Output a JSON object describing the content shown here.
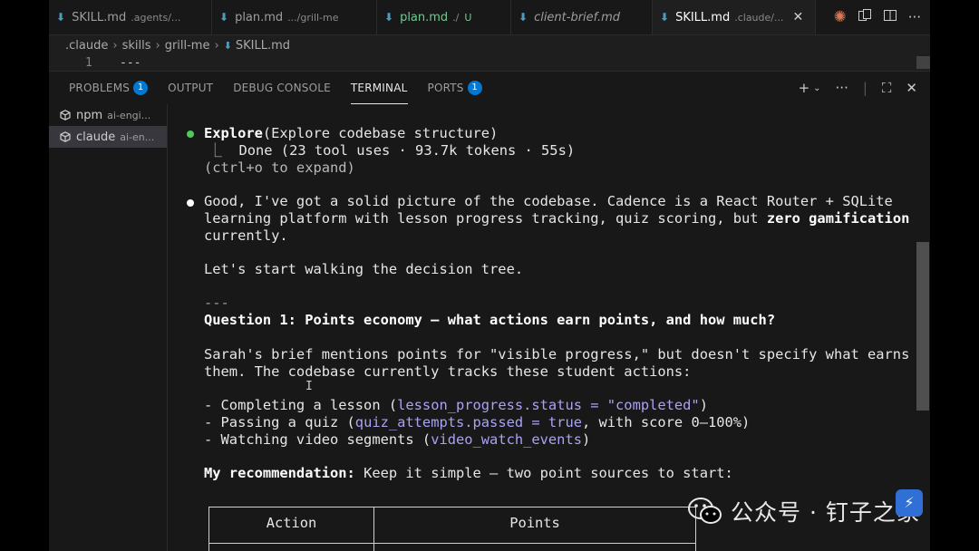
{
  "tabs": [
    {
      "label": "SKILL.md",
      "desc": ".agents/...",
      "style": "normal"
    },
    {
      "label": "plan.md",
      "desc": ".../grill-me",
      "style": "normal"
    },
    {
      "label": "plan.md",
      "desc": "./",
      "status": "U",
      "style": "modified"
    },
    {
      "label": "client-brief.md",
      "desc": "",
      "style": "italic"
    },
    {
      "label": "SKILL.md",
      "desc": ".claude/...",
      "style": "active"
    }
  ],
  "tab_close_glyph": "✕",
  "breadcrumb": [
    ".claude",
    "skills",
    "grill-me",
    "SKILL.md"
  ],
  "editor": {
    "line_number": "1",
    "line_text": "---"
  },
  "panel": {
    "tabs": [
      {
        "label": "PROBLEMS",
        "badge": "1"
      },
      {
        "label": "OUTPUT"
      },
      {
        "label": "DEBUG CONSOLE"
      },
      {
        "label": "TERMINAL",
        "active": true
      },
      {
        "label": "PORTS",
        "badge": "1"
      }
    ],
    "actions": {
      "add": "+",
      "dropdown": "⌄",
      "more": "···",
      "maximize": "⛶",
      "close": "✕"
    }
  },
  "terminals": [
    {
      "name": "npm",
      "desc": "ai-engi..."
    },
    {
      "name": "claude",
      "desc": "ai-en...",
      "active": true
    }
  ],
  "terminal": {
    "explore_tool": "Explore",
    "explore_args": "(Explore codebase structure)",
    "done_prefix": "  ⎿  ",
    "done_text": "Done (23 tool uses · 93.7k tokens · 55s)",
    "expand_hint": "(ctrl+o to expand)",
    "p1_line1": "Good, I've got a solid picture of the codebase. Cadence is a React Router + SQLite",
    "p1_line2a": "learning platform with lesson progress tracking, quiz scoring, but ",
    "p1_line2b": "zero gamification",
    "p1_line3": "currently.",
    "p2": "Let's start walking the decision tree.",
    "rule": "---",
    "question": "Question 1: Points economy — what actions earn points, and how much?",
    "p3_line1": "Sarah's brief mentions points for \"visible progress,\" but doesn't specify what earns",
    "p3_line2": "them. The codebase currently tracks these student actions:",
    "list": [
      {
        "pre": "- Completing a lesson (",
        "code": "lesson_progress.status = \"completed\"",
        "post": ")"
      },
      {
        "pre": "- Passing a quiz (",
        "code": "quiz_attempts.passed = true",
        "post": ", with score 0–100%)"
      },
      {
        "pre": "- Watching video segments (",
        "code": "video_watch_events",
        "post": ")"
      }
    ],
    "rec_label": "My recommendation:",
    "rec_text": " Keep it simple — two point sources to start:",
    "table_headers": [
      "Action",
      "Points"
    ]
  },
  "watermark": {
    "text": "公众号 · 钉子之家"
  },
  "colors": {
    "accent": "#0078d4",
    "bullet_green": "#4ec95a",
    "code": "#a9a3f5",
    "markdown_icon": "#519aba",
    "claude_spark": "#d97757"
  }
}
